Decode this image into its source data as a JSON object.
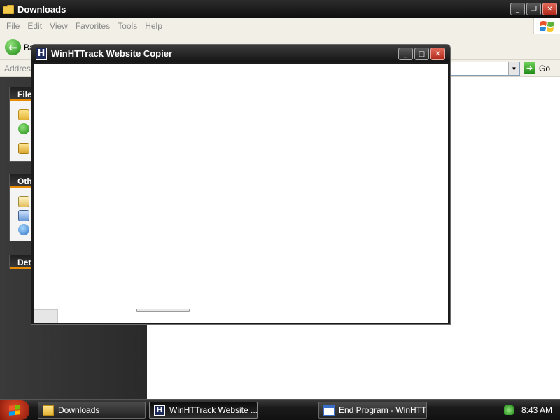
{
  "explorer": {
    "title": "Downloads",
    "menu": [
      "File",
      "Edit",
      "View",
      "Favorites",
      "Tools",
      "Help"
    ],
    "toolbar": {
      "back_label": "Ba"
    },
    "address": {
      "label": "Address",
      "value": "",
      "go_label": "Go"
    },
    "tasks": {
      "file_header": "File",
      "other_header": "Oth",
      "details_header": "Det"
    },
    "caption": {
      "minimize": "_",
      "maximize": "❐",
      "close": "✕"
    }
  },
  "httrack": {
    "title": "WinHTTrack Website Copier",
    "logo": "H",
    "caption": {
      "minimize": "_",
      "maximize": "□",
      "close": "✕"
    }
  },
  "taskbar": {
    "buttons": [
      {
        "label": "Downloads"
      },
      {
        "label": "WinHTTrack Website ..."
      },
      {
        "label": "End Program - WinHTT..."
      }
    ],
    "clock": "8:43 AM"
  },
  "colors": {
    "accent": "#e68a00",
    "titlebar": "#1a1a1a",
    "close": "#c0392b"
  }
}
